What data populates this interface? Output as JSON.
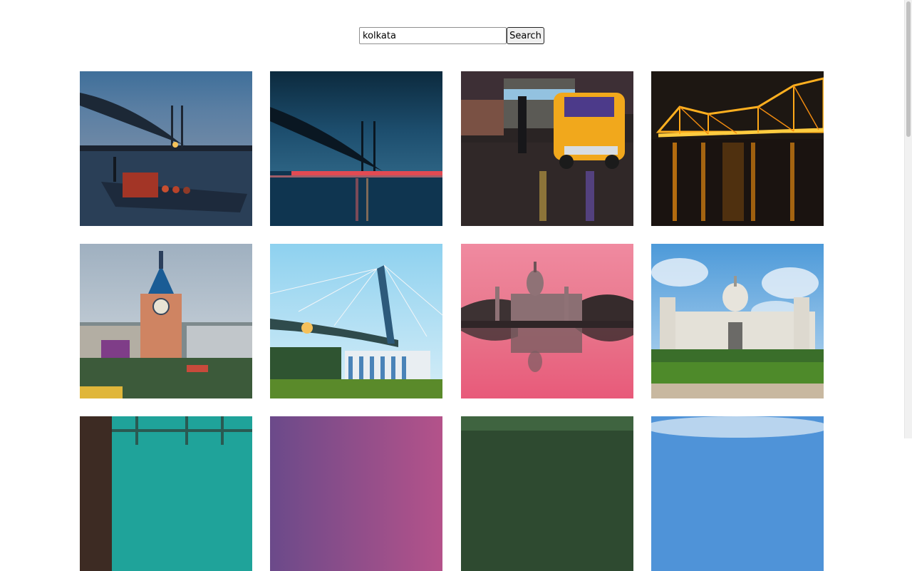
{
  "search": {
    "value": "kolkata",
    "button_label": "Search"
  },
  "gallery": {
    "photos": [
      {
        "subject": "second-hooghly-bridge-dusk-boat"
      },
      {
        "subject": "second-hooghly-bridge-night"
      },
      {
        "subject": "yellow-taxi-rainy-street"
      },
      {
        "subject": "howrah-bridge-night-lights"
      },
      {
        "subject": "clock-tower-city"
      },
      {
        "subject": "second-hooghly-bridge-pavilion"
      },
      {
        "subject": "victoria-memorial-pink-reflection"
      },
      {
        "subject": "victoria-memorial-day"
      },
      {
        "subject": "partial-photo-teal"
      },
      {
        "subject": "partial-photo-purple"
      },
      {
        "subject": "partial-photo-green"
      },
      {
        "subject": "partial-photo-sky"
      }
    ]
  }
}
